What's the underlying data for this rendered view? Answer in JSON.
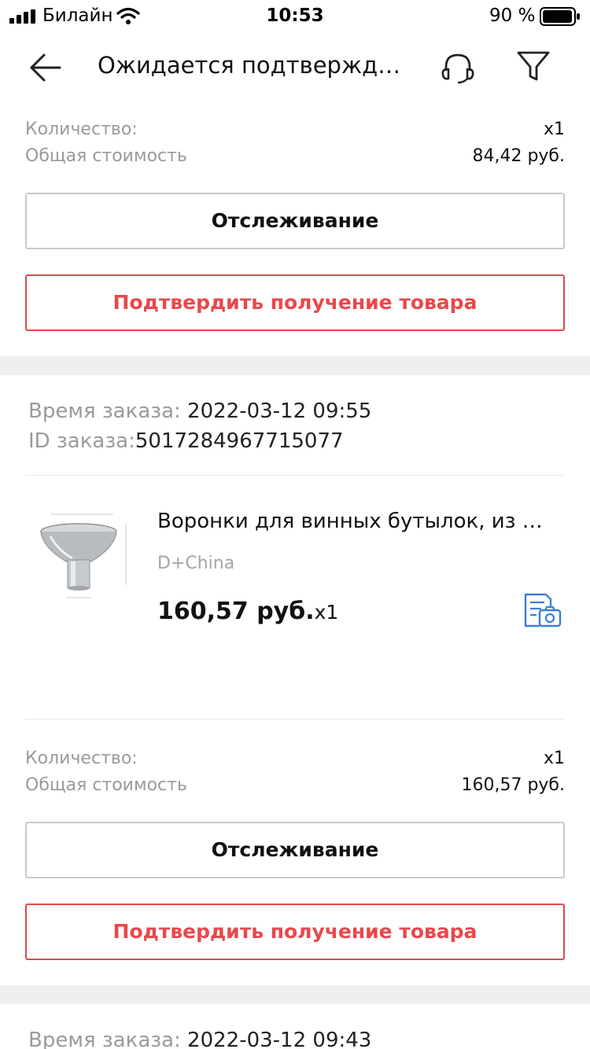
{
  "status_bar": {
    "carrier": "Билайн",
    "time": "10:53",
    "battery": "90 %"
  },
  "header": {
    "title": "Ожидается подтвержде...",
    "icons": [
      "arrow-left-icon",
      "headset-icon",
      "funnel-icon"
    ]
  },
  "order_prev": {
    "quantity_label": "Количество:",
    "quantity_value": "x1",
    "total_label": "Общая стоимость",
    "total_value": "84,42 руб.",
    "track_button": "Отслеживание",
    "confirm_button": "Подтвердить получение товара"
  },
  "order_main": {
    "time_label": "Время заказа:",
    "time_value": " 2022-03-12 09:55",
    "id_label": "ID заказа:",
    "id_value": "5017284967715077",
    "product": {
      "name": "Воронки для винных бутылок, из н...",
      "store": "D+China",
      "price": "160,57 руб.",
      "qty": "x1"
    },
    "quantity_label": "Количество:",
    "quantity_value": "x1",
    "total_label": "Общая стоимость",
    "total_value": "160,57 руб.",
    "track_button": "Отслеживание",
    "confirm_button": "Подтвердить получение товара"
  },
  "order_next": {
    "time_label": "Время заказа:",
    "time_value": " 2022-03-12 09:43"
  },
  "colors": {
    "accent_red": "#e8484c",
    "review_icon_blue": "#3a7fd5",
    "separator": "#efefef"
  }
}
